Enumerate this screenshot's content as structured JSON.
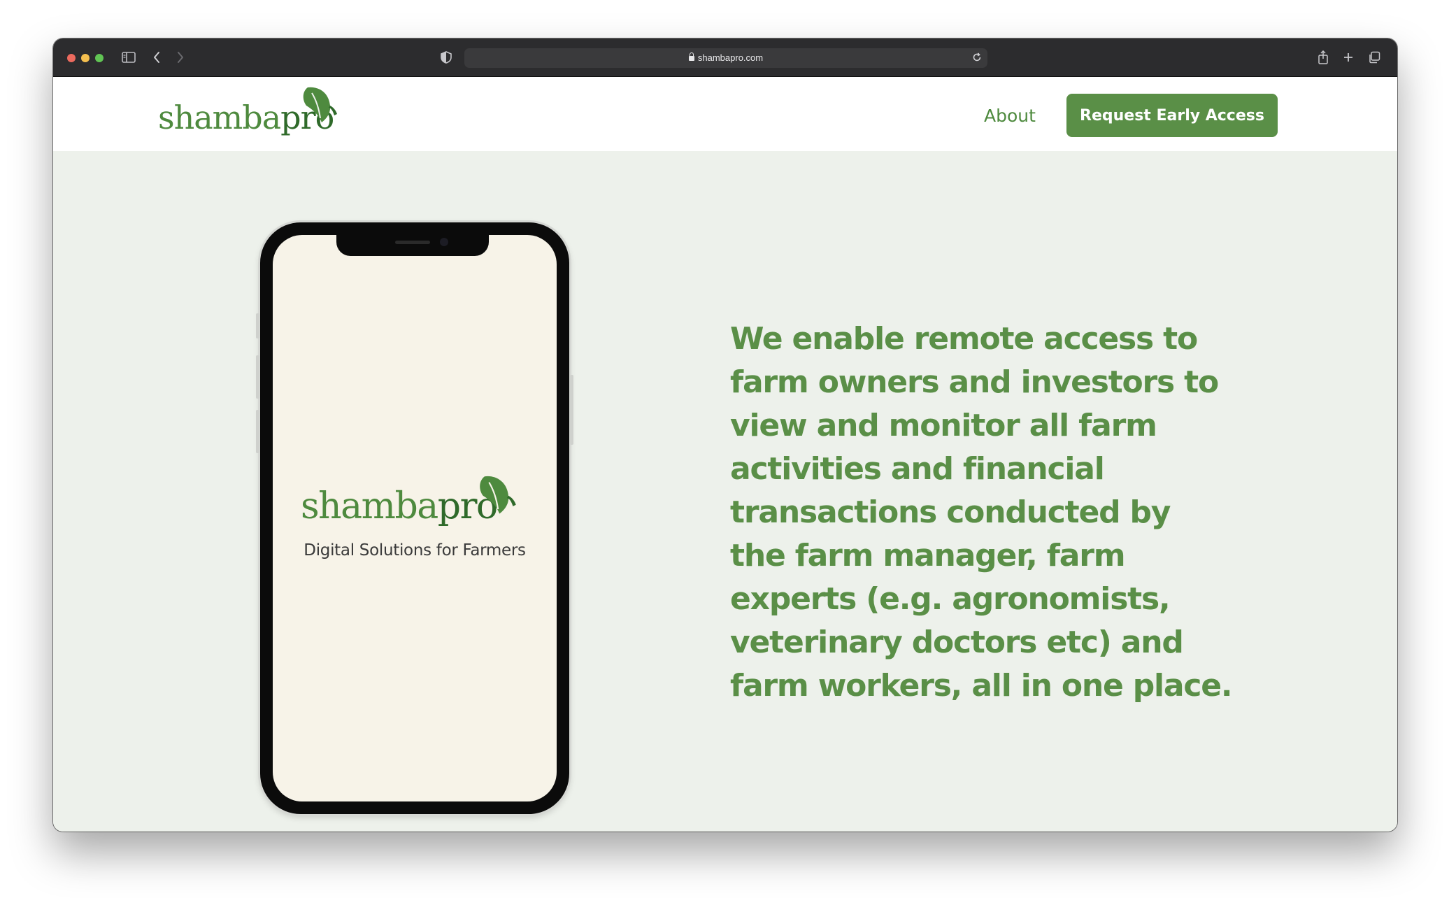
{
  "browser": {
    "url": "shambapro.com"
  },
  "header": {
    "logo_text_main": "shamba",
    "logo_text_accent": "pro",
    "nav_about": "About",
    "cta_label": "Request Early Access"
  },
  "phone": {
    "logo_text_main": "shamba",
    "logo_text_accent": "pro",
    "tagline": "Digital Solutions for Farmers"
  },
  "hero": {
    "headline": "We enable remote access to farm owners and investors to view and monitor all farm activities and financial transactions conducted by the farm manager, farm experts (e.g. agronomists, veterinary doctors etc) and farm workers, all in one place."
  },
  "colors": {
    "brand_green": "#5a8f47",
    "brand_dark_green": "#2f6a2a",
    "hero_background": "#edf1eb",
    "phone_screen": "#f7f3e8"
  }
}
